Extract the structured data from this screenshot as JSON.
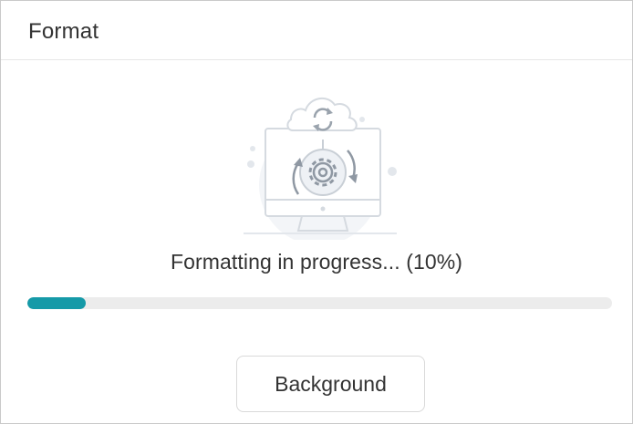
{
  "dialog": {
    "title": "Format"
  },
  "illustration": {
    "icon": "cloud-sync-gear-monitor-icon"
  },
  "progress": {
    "status_text": "Formatting in progress... (10%)",
    "percent": 10,
    "fill_color": "#159aa8",
    "track_color": "#ececec"
  },
  "actions": {
    "background_label": "Background"
  }
}
